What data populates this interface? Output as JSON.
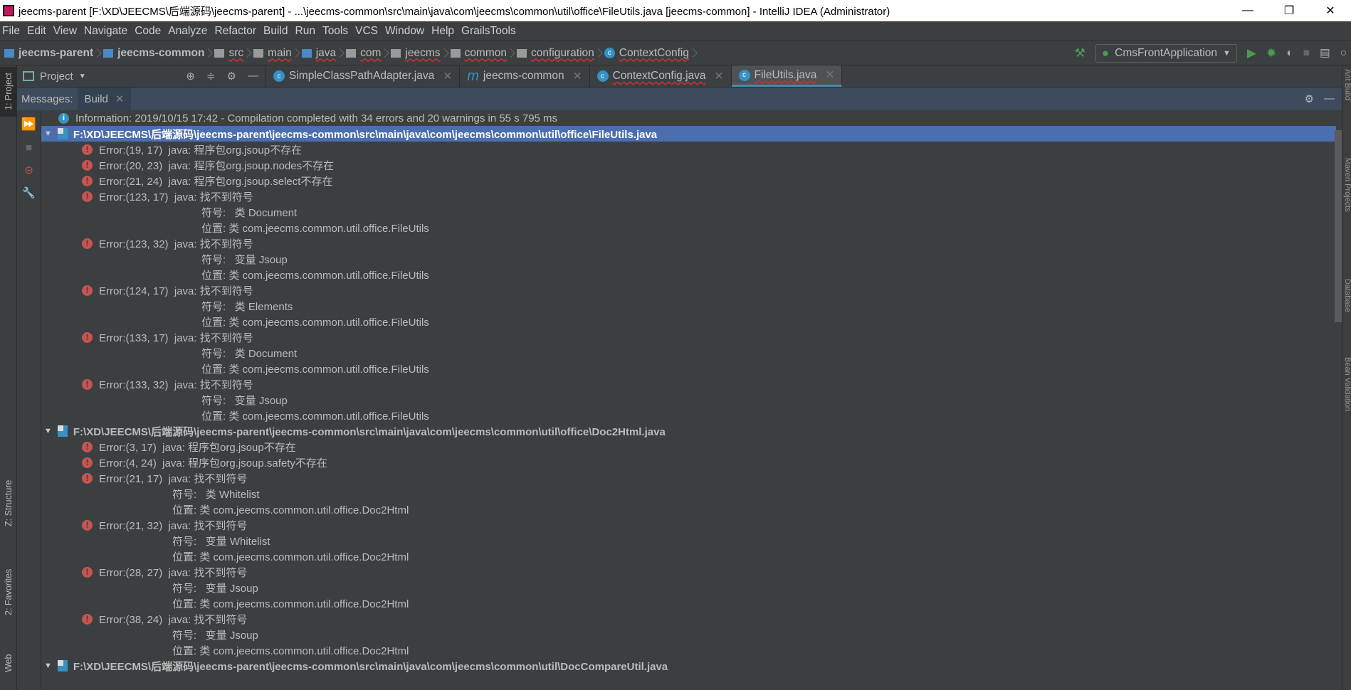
{
  "window": {
    "title": "jeecms-parent [F:\\XD\\JEECMS\\后端源码\\jeecms-parent] - ...\\jeecms-common\\src\\main\\java\\com\\jeecms\\common\\util\\office\\FileUtils.java [jeecms-common] - IntelliJ IDEA (Administrator)",
    "minimize": "—",
    "maximize": "❐",
    "close": "✕"
  },
  "menu": [
    "File",
    "Edit",
    "View",
    "Navigate",
    "Code",
    "Analyze",
    "Refactor",
    "Build",
    "Run",
    "Tools",
    "VCS",
    "Window",
    "Help",
    "GrailsTools"
  ],
  "breadcrumbs": [
    "jeecms-parent",
    "jeecms-common",
    "src",
    "main",
    "java",
    "com",
    "jeecms",
    "common",
    "configuration",
    "ContextConfig"
  ],
  "run_config": "CmsFrontApplication",
  "project_pane": {
    "label": "Project"
  },
  "editor_tabs": [
    {
      "label": "SimpleClassPathAdapter.java",
      "icon": "C"
    },
    {
      "label": "jeecms-common",
      "icon": "m"
    },
    {
      "label": "ContextConfig.java",
      "icon": "C"
    },
    {
      "label": "FileUtils.java",
      "icon": "C",
      "active": true
    }
  ],
  "left_strip": [
    "1: Project",
    "Z: Structure",
    "2: Favorites",
    "Web"
  ],
  "right_strip": [
    "Ant Build",
    "Maven Projects",
    "Database",
    "Bean Validation"
  ],
  "messages": {
    "label": "Messages:",
    "tab": "Build"
  },
  "info": "Information: 2019/10/15 17:42 - Compilation completed with 34 errors and 20 warnings in 55 s 795 ms",
  "files": [
    {
      "path": "F:\\XD\\JEECMS\\后端源码\\jeecms-parent\\jeecms-common\\src\\main\\java\\com\\jeecms\\common\\util\\office\\FileUtils.java",
      "selected": true,
      "indent": "                        ",
      "errors": [
        {
          "text": "Error:(19, 17)  java: 程序包org.jsoup不存在"
        },
        {
          "text": "Error:(20, 23)  java: 程序包org.jsoup.nodes不存在"
        },
        {
          "text": "Error:(21, 24)  java: 程序包org.jsoup.select不存在"
        },
        {
          "text": "Error:(123, 17)  java: 找不到符号",
          "sub": [
            "符号:   类 Document",
            "位置: 类 com.jeecms.common.util.office.FileUtils"
          ]
        },
        {
          "text": "Error:(123, 32)  java: 找不到符号",
          "sub": [
            "符号:   变量 Jsoup",
            "位置: 类 com.jeecms.common.util.office.FileUtils"
          ]
        },
        {
          "text": "Error:(124, 17)  java: 找不到符号",
          "sub": [
            "符号:   类 Elements",
            "位置: 类 com.jeecms.common.util.office.FileUtils"
          ]
        },
        {
          "text": "Error:(133, 17)  java: 找不到符号",
          "sub": [
            "符号:   类 Document",
            "位置: 类 com.jeecms.common.util.office.FileUtils"
          ]
        },
        {
          "text": "Error:(133, 32)  java: 找不到符号",
          "sub": [
            "符号:   变量 Jsoup",
            "位置: 类 com.jeecms.common.util.office.FileUtils"
          ]
        }
      ]
    },
    {
      "path": "F:\\XD\\JEECMS\\后端源码\\jeecms-parent\\jeecms-common\\src\\main\\java\\com\\jeecms\\common\\util\\office\\Doc2Html.java",
      "selected": false,
      "indent": "                    ",
      "errors": [
        {
          "text": "Error:(3, 17)  java: 程序包org.jsoup不存在"
        },
        {
          "text": "Error:(4, 24)  java: 程序包org.jsoup.safety不存在"
        },
        {
          "text": "Error:(21, 17)  java: 找不到符号",
          "sub": [
            "符号:   类 Whitelist",
            "位置: 类 com.jeecms.common.util.office.Doc2Html"
          ]
        },
        {
          "text": "Error:(21, 32)  java: 找不到符号",
          "sub": [
            "符号:   变量 Whitelist",
            "位置: 类 com.jeecms.common.util.office.Doc2Html"
          ]
        },
        {
          "text": "Error:(28, 27)  java: 找不到符号",
          "sub": [
            "符号:   变量 Jsoup",
            "位置: 类 com.jeecms.common.util.office.Doc2Html"
          ]
        },
        {
          "text": "Error:(38, 24)  java: 找不到符号",
          "sub": [
            "符号:   变量 Jsoup",
            "位置: 类 com.jeecms.common.util.office.Doc2Html"
          ]
        }
      ]
    },
    {
      "path": "F:\\XD\\JEECMS\\后端源码\\jeecms-parent\\jeecms-common\\src\\main\\java\\com\\jeecms\\common\\util\\DocCompareUtil.java",
      "selected": false,
      "indent": "",
      "errors": []
    }
  ]
}
